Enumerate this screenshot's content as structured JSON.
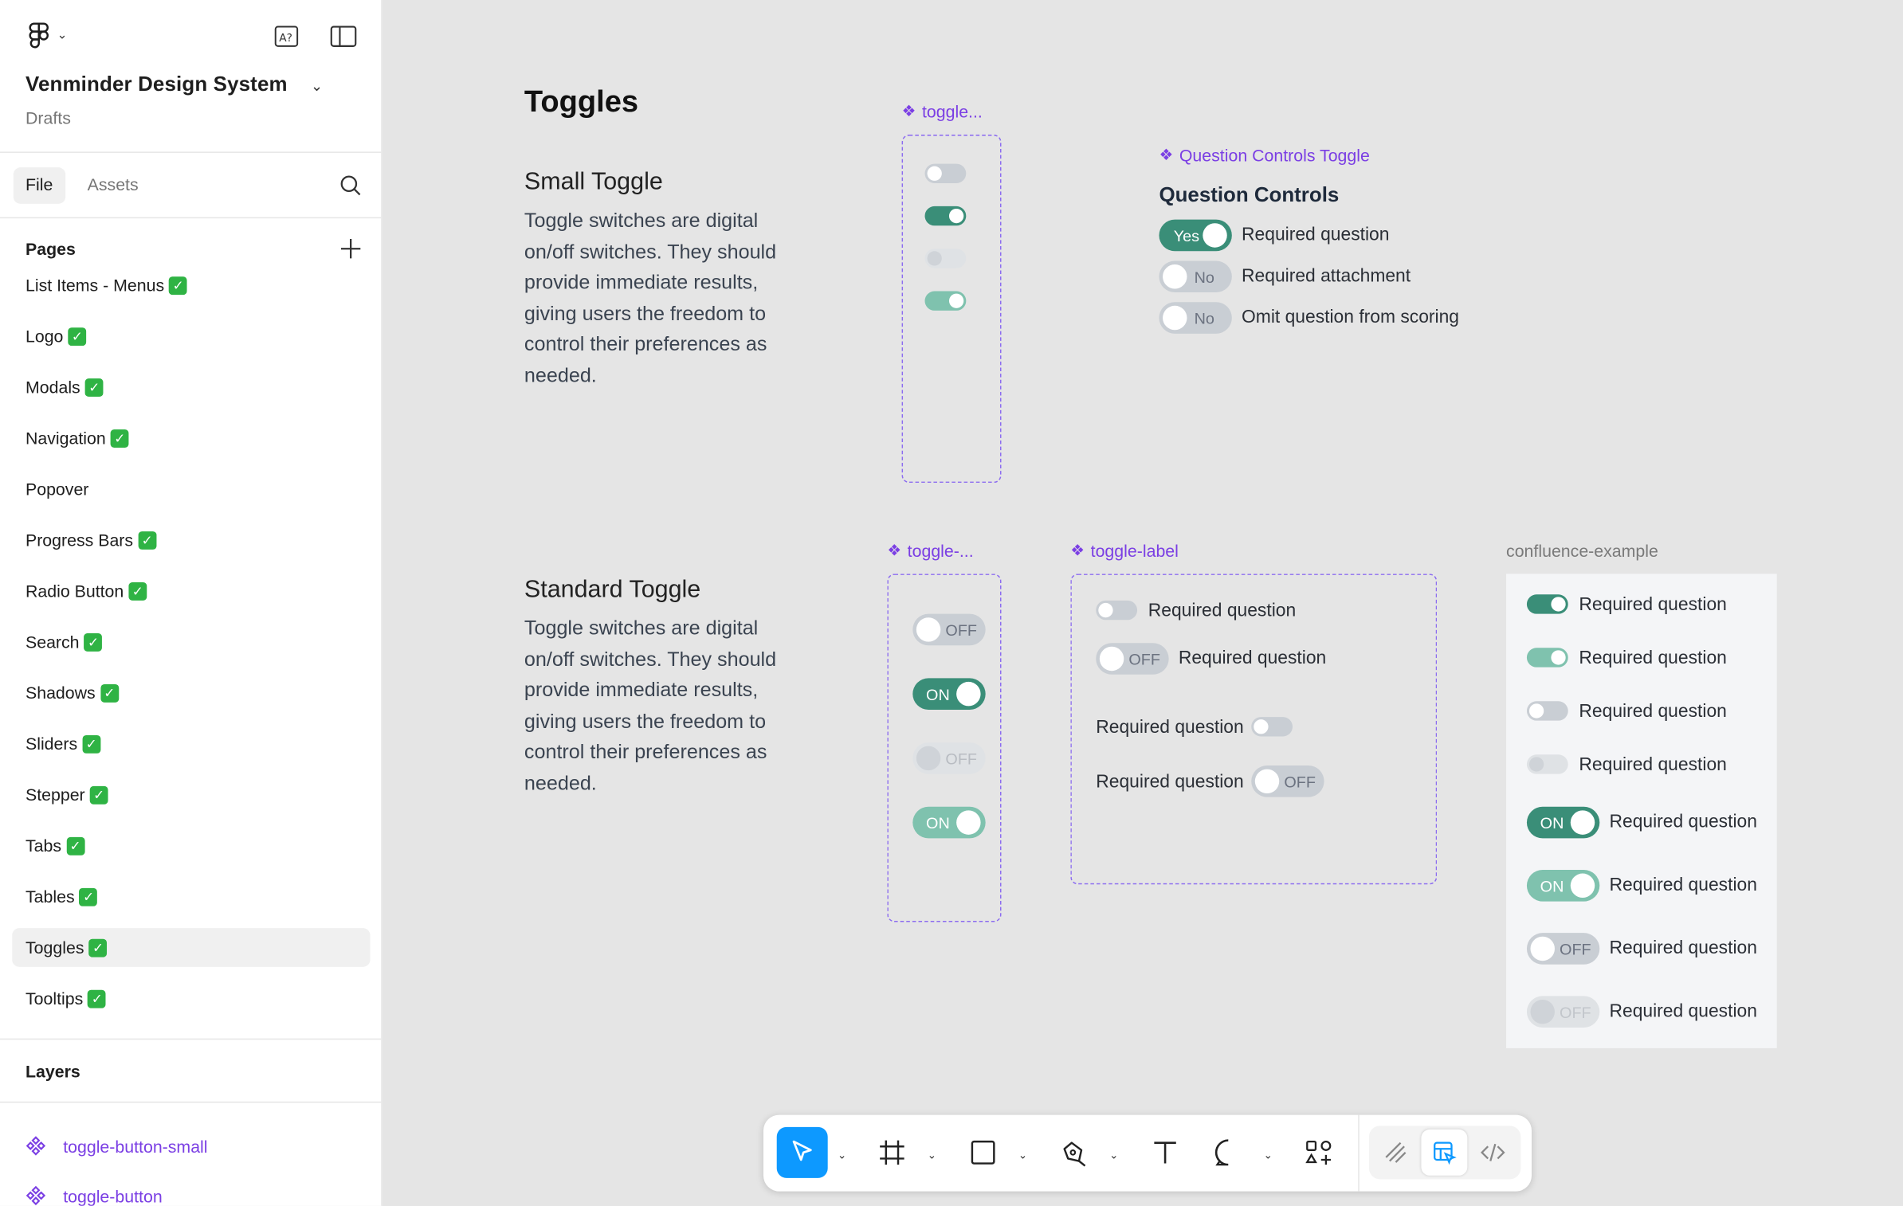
{
  "sidebar": {
    "project_title": "Venminder Design System",
    "project_subtitle": "Drafts",
    "tabs": [
      "File",
      "Assets"
    ],
    "pages_header": "Pages",
    "pages": [
      {
        "label": "List Items - Menus",
        "checked": true
      },
      {
        "label": "Logo",
        "checked": true
      },
      {
        "label": "Modals",
        "checked": true
      },
      {
        "label": "Navigation",
        "checked": true
      },
      {
        "label": "Popover",
        "checked": false
      },
      {
        "label": "Progress Bars",
        "checked": true
      },
      {
        "label": "Radio Button",
        "checked": true
      },
      {
        "label": "Search",
        "checked": true
      },
      {
        "label": "Shadows",
        "checked": true
      },
      {
        "label": "Sliders",
        "checked": true
      },
      {
        "label": "Stepper",
        "checked": true
      },
      {
        "label": "Tabs",
        "checked": true
      },
      {
        "label": "Tables",
        "checked": true
      },
      {
        "label": "Toggles",
        "checked": true,
        "active": true
      },
      {
        "label": "Tooltips",
        "checked": true
      }
    ],
    "check_glyph": "✓",
    "layers_header": "Layers",
    "layers": [
      "toggle-button-small",
      "toggle-button"
    ]
  },
  "canvas": {
    "title": "Toggles",
    "small": {
      "title": "Small Toggle",
      "description": "Toggle switches are digital on/off switches. They should provide immediate results, giving users the freedom to control their preferences as needed.",
      "component_label": "toggle..."
    },
    "question_controls": {
      "component_label": "Question Controls Toggle",
      "heading": "Question Controls",
      "items": [
        {
          "toggle": "Yes",
          "label": "Required question"
        },
        {
          "toggle": "No",
          "label": "Required attachment"
        },
        {
          "toggle": "No",
          "label": "Omit question from scoring"
        }
      ]
    },
    "standard": {
      "title": "Standard Toggle",
      "description": "Toggle switches are digital on/off switches. They should provide immediate results, giving users the freedom to control their preferences as needed.",
      "component_label": "toggle-...",
      "toggles": [
        "OFF",
        "ON",
        "OFF",
        "ON"
      ]
    },
    "toggle_label": {
      "component_label": "toggle-label",
      "rows": [
        {
          "label": "Required question",
          "toggle": ""
        },
        {
          "label": "Required question",
          "toggle": "OFF"
        },
        {
          "label": "Required question",
          "toggle": ""
        },
        {
          "label": "Required question",
          "toggle": "OFF"
        }
      ]
    },
    "confluence": {
      "label": "confluence-example",
      "rows": [
        {
          "label": "Required question",
          "toggle": ""
        },
        {
          "label": "Required question",
          "toggle": ""
        },
        {
          "label": "Required question",
          "toggle": ""
        },
        {
          "label": "Required question",
          "toggle": ""
        },
        {
          "label": "Required question",
          "toggle": "ON"
        },
        {
          "label": "Required question",
          "toggle": "ON"
        },
        {
          "label": "Required question",
          "toggle": "OFF"
        },
        {
          "label": "Required question",
          "toggle": "OFF"
        }
      ]
    }
  },
  "colors": {
    "accent": "#7b3fe4",
    "toggle_on": "#3a8e78",
    "toggle_off": "#c9ced4",
    "select": "#0d99ff"
  },
  "toolbar": {
    "tools": [
      "move-tool",
      "frame-tool",
      "rectangle-tool",
      "pen-tool",
      "text-tool",
      "comment-tool",
      "actions-tool"
    ],
    "modes": [
      "draw-mode",
      "design-mode",
      "dev-mode"
    ]
  }
}
